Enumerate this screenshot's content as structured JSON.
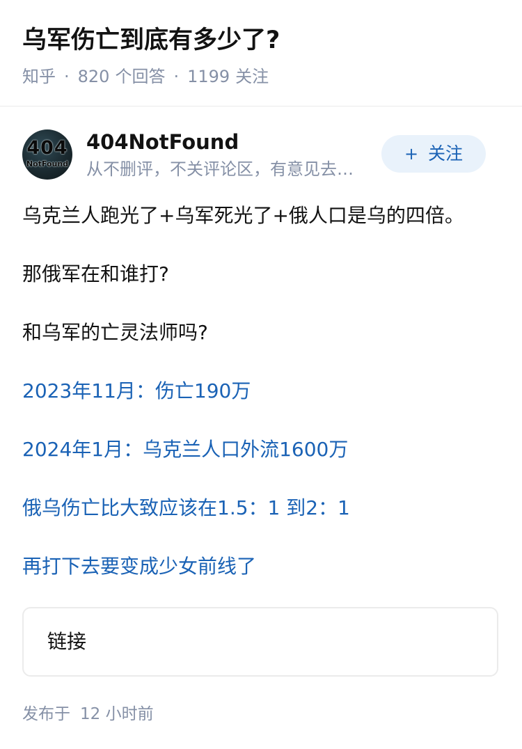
{
  "question": {
    "title": "乌军伤亡到底有多少了?",
    "meta": {
      "source": "知乎",
      "answers_count": "820",
      "answers_label": "个回答",
      "followers_count": "1199",
      "followers_label": "关注",
      "separator": "·"
    }
  },
  "author": {
    "avatar_text_big": "404",
    "avatar_text_small": "NotFound",
    "name": "404NotFound",
    "bio": "从不删评，不关评论区，有意见去…",
    "follow_plus": "+",
    "follow_label": "关注"
  },
  "answer": {
    "paragraphs": [
      "乌克兰人跑光了+乌军死光了+俄人口是乌的四倍。",
      "那俄军在和谁打?",
      "和乌军的亡灵法师吗?",
      "2023年11月：伤亡190万",
      "2024年1月：乌克兰人口外流1600万",
      "俄乌伤亡比大致应该在1.5：1 到2：1",
      "再打下去要变成少女前线了"
    ],
    "link_card_label": "链接"
  },
  "footer": {
    "publish_label": "发布于",
    "publish_time": "12 小时前"
  },
  "colors": {
    "link_blue": "#1a62b5",
    "meta_gray": "#8590a6",
    "follow_bg": "#e9f2fb"
  }
}
